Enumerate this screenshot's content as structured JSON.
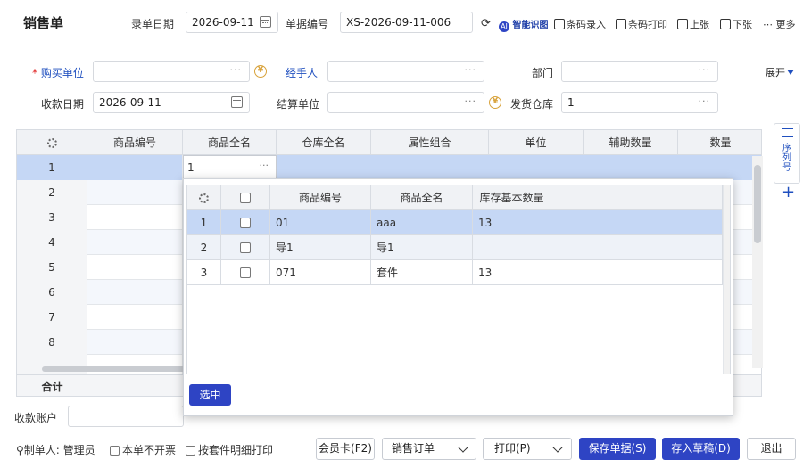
{
  "header": {
    "title": "销售单",
    "entry_date_label": "录单日期",
    "entry_date_value": "2026-09-11",
    "doc_no_label": "单据编号",
    "doc_no_value": "XS-2026-09-11-006"
  },
  "toolbar": {
    "ai_label": "智能识图",
    "barcode_entry": "条码录入",
    "barcode_print": "条码打印",
    "prev": "上张",
    "next": "下张",
    "more": "更多"
  },
  "form": {
    "buyer_label": "购买单位",
    "buyer_value": "",
    "handler_label": "经手人",
    "handler_value": "",
    "dept_label": "部门",
    "dept_value": "",
    "expand_label": "展开",
    "receive_date_label": "收款日期",
    "receive_date_value": "2026-09-11",
    "settle_label": "结算单位",
    "settle_value": "",
    "warehouse_label": "发货仓库",
    "warehouse_value": "1"
  },
  "grid": {
    "columns": [
      "商品编号",
      "商品全名",
      "仓库全名",
      "属性组合",
      "单位",
      "辅助数量",
      "数量"
    ],
    "rows": [
      "1",
      "2",
      "3",
      "4",
      "5",
      "6",
      "7",
      "8"
    ],
    "edit_value": "1",
    "total_label": "合计",
    "side_label": "序列号"
  },
  "popup": {
    "columns": [
      "商品编号",
      "商品全名",
      "库存基本数量"
    ],
    "rows": [
      {
        "idx": "1",
        "code": "01",
        "name": "aaa",
        "qty": "13"
      },
      {
        "idx": "2",
        "code": "导1",
        "name": "导1",
        "qty": ""
      },
      {
        "idx": "3",
        "code": "071",
        "name": "套件",
        "qty": "13"
      }
    ],
    "select_button": "选中"
  },
  "footer": {
    "account_label": "收款账户",
    "maker_label": "制单人:",
    "maker_value": "管理员",
    "no_invoice": "本单不开票",
    "print_by_detail": "按套件明细打印",
    "member_card": "会员卡(F2)",
    "sales_order": "销售订单",
    "print": "打印(P)",
    "save": "保存单据(S)",
    "draft": "存入草稿(D)",
    "exit": "退出"
  }
}
